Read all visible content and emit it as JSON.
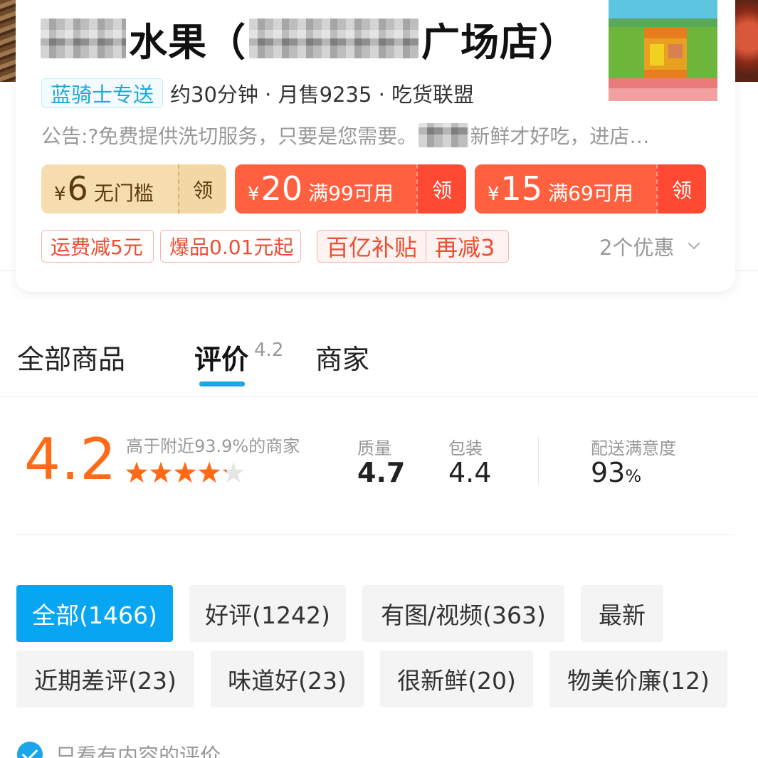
{
  "store": {
    "name_part1": "水果（",
    "name_part2": "广场店）",
    "rider_badge": "蓝骑士专送",
    "meta": "约30分钟 · 月售9235 · 吃货联盟",
    "notice_prefix": "公告:?免费提供洗切服务，只要是您需要。",
    "notice_suffix": "新鲜才好吃，进店…"
  },
  "coupons": [
    {
      "yen": "¥",
      "amount": "6",
      "condition": "无门槛",
      "claim": "领"
    },
    {
      "yen": "¥",
      "amount": "20",
      "condition": "满99可用",
      "claim": "领"
    },
    {
      "yen": "¥",
      "amount": "15",
      "condition": "满69可用",
      "claim": "领"
    }
  ],
  "promos": {
    "delivery_discount": "运费减5元",
    "hot_items": "爆品0.01元起",
    "subsidy": "百亿补贴",
    "subsidy_extra": "再减3",
    "more": "2个优惠"
  },
  "tabs": {
    "products": "全部商品",
    "reviews": "评价",
    "reviews_score": "4.2",
    "merchant": "商家"
  },
  "rating": {
    "score": "4.2",
    "compare": "高于附近93.9%的商家",
    "stars_value": 4.2,
    "quality_label": "质量",
    "quality_value": "4.7",
    "packaging_label": "包装",
    "packaging_value": "4.4",
    "delivery_label": "配送满意度",
    "delivery_value": "93",
    "delivery_unit": "%"
  },
  "filters": [
    {
      "label": "全部(1466)",
      "active": true
    },
    {
      "label": "好评(1242)",
      "active": false
    },
    {
      "label": "有图/视频(363)",
      "active": false
    },
    {
      "label": "最新",
      "active": false
    },
    {
      "label": "近期差评(23)",
      "active": false
    },
    {
      "label": "味道好(23)",
      "active": false
    },
    {
      "label": "很新鲜(20)",
      "active": false
    },
    {
      "label": "物美价廉(12)",
      "active": false
    }
  ],
  "content_only_label": "只看有内容的评价",
  "colors": {
    "accent_blue": "#1aa6e8",
    "score_orange": "#ff6a16",
    "coupon_red": "#ff6140",
    "coupon_gold": "#f6ddb0"
  }
}
